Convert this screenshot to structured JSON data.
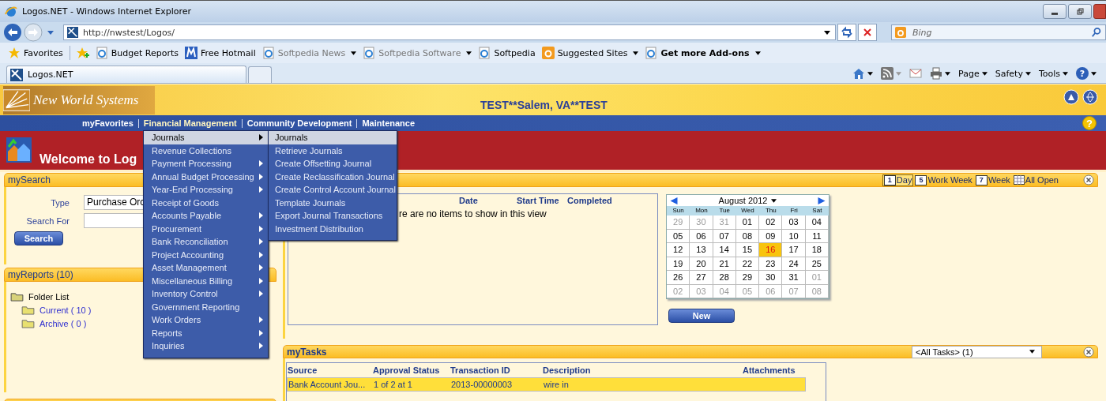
{
  "browser": {
    "title": "Logos.NET - Windows Internet Explorer",
    "address": "http://nwstest/Logos/",
    "search_placeholder": "Bing",
    "favorites_label": "Favorites",
    "favorites": [
      {
        "label": "Budget Reports",
        "dimmed": false,
        "has_menu": false,
        "bold": false
      },
      {
        "label": "Free Hotmail",
        "dimmed": false,
        "has_menu": false,
        "bold": false
      },
      {
        "label": "Softpedia News",
        "dimmed": true,
        "has_menu": true,
        "bold": false
      },
      {
        "label": "Softpedia Software",
        "dimmed": true,
        "has_menu": true,
        "bold": false
      },
      {
        "label": "Softpedia",
        "dimmed": false,
        "has_menu": false,
        "bold": false
      },
      {
        "label": "Suggested Sites",
        "dimmed": false,
        "has_menu": true,
        "bold": false
      },
      {
        "label": "Get more Add-ons",
        "dimmed": false,
        "has_menu": true,
        "bold": true
      }
    ],
    "tabs": [
      {
        "label": "Logos.NET",
        "selected": true
      }
    ],
    "commands": [
      {
        "kind": "home",
        "has_menu": true
      },
      {
        "kind": "feeds",
        "has_menu": true
      },
      {
        "kind": "mail",
        "has_menu": false
      },
      {
        "kind": "print",
        "has_menu": true
      },
      {
        "kind": "text",
        "label": "Page",
        "has_menu": true
      },
      {
        "kind": "text",
        "label": "Safety",
        "has_menu": true
      },
      {
        "kind": "text",
        "label": "Tools",
        "has_menu": true
      },
      {
        "kind": "help",
        "label": "?",
        "has_menu": true
      }
    ]
  },
  "app": {
    "brand": "New World Systems",
    "site": "TEST**Salem, VA**TEST",
    "help": "?",
    "welcome": "Welcome to Log",
    "nav": [
      {
        "label": "myFavorites",
        "selected": false
      },
      {
        "label": "Financial Management",
        "selected": true
      },
      {
        "label": "Community Development",
        "selected": false
      },
      {
        "label": "Maintenance",
        "selected": false
      }
    ],
    "main_menu": [
      {
        "label": "Journals",
        "has_submenu": true,
        "selected": true
      },
      {
        "label": "Revenue Collections",
        "has_submenu": false,
        "selected": false
      },
      {
        "label": "Payment Processing",
        "has_submenu": true,
        "selected": false
      },
      {
        "label": "Annual Budget Processing",
        "has_submenu": true,
        "selected": false
      },
      {
        "label": "Year-End Processing",
        "has_submenu": true,
        "selected": false
      },
      {
        "label": "Receipt of Goods",
        "has_submenu": false,
        "selected": false
      },
      {
        "label": "Accounts Payable",
        "has_submenu": true,
        "selected": false
      },
      {
        "label": "Procurement",
        "has_submenu": true,
        "selected": false
      },
      {
        "label": "Bank Reconciliation",
        "has_submenu": true,
        "selected": false
      },
      {
        "label": "Project Accounting",
        "has_submenu": true,
        "selected": false
      },
      {
        "label": "Asset Management",
        "has_submenu": true,
        "selected": false
      },
      {
        "label": "Miscellaneous Billing",
        "has_submenu": true,
        "selected": false
      },
      {
        "label": "Inventory Control",
        "has_submenu": true,
        "selected": false
      },
      {
        "label": "Government Reporting",
        "has_submenu": false,
        "selected": false
      },
      {
        "label": "Work Orders",
        "has_submenu": true,
        "selected": false
      },
      {
        "label": "Reports",
        "has_submenu": true,
        "selected": false
      },
      {
        "label": "Inquiries",
        "has_submenu": true,
        "selected": false
      }
    ],
    "submenu": [
      {
        "label": "Journals",
        "selected": true
      },
      {
        "label": "Retrieve Journals",
        "selected": false
      },
      {
        "label": "Create Offsetting Journal",
        "selected": false
      },
      {
        "label": "Create Reclassification Journal",
        "selected": false
      },
      {
        "label": "Create Control Account Journal",
        "selected": false
      },
      {
        "label": "Template Journals",
        "selected": false
      },
      {
        "label": "Export Journal Transactions",
        "selected": false
      },
      {
        "label": "Investment Distribution",
        "selected": false
      }
    ],
    "search_panel": {
      "title": "mySearch",
      "type_label": "Type",
      "type_value": "Purchase Orc",
      "search_for_label": "Search For",
      "button": "Search"
    },
    "reports_panel": {
      "title": "myReports (10)",
      "root": {
        "label": "Folder List",
        "children": [
          {
            "label": "Current ( 10 )"
          },
          {
            "label": "Archive ( 0 )"
          }
        ]
      }
    },
    "calendar_panel": {
      "views": [
        {
          "kind": "digit",
          "icon": "1",
          "label": "Day",
          "selected": true
        },
        {
          "kind": "digit",
          "icon": "5",
          "label": "Work Week",
          "selected": false
        },
        {
          "kind": "digit",
          "icon": "7",
          "label": "Week",
          "selected": false
        },
        {
          "kind": "grid",
          "label": "All Open",
          "selected": false
        }
      ],
      "columns": [
        "Date",
        "Start Time",
        "Completed"
      ],
      "empty_message": "re are no items to show in this view",
      "month": "August 2012",
      "weekdays": [
        "Sun",
        "Mon",
        "Tue",
        "Wed",
        "Thu",
        "Fri",
        "Sat"
      ],
      "weeks": [
        [
          {
            "day": "29",
            "other_month": true,
            "today": false
          },
          {
            "day": "30",
            "other_month": true,
            "today": false
          },
          {
            "day": "31",
            "other_month": true,
            "today": false
          },
          {
            "day": "01",
            "other_month": false,
            "today": false
          },
          {
            "day": "02",
            "other_month": false,
            "today": false
          },
          {
            "day": "03",
            "other_month": false,
            "today": false
          },
          {
            "day": "04",
            "other_month": false,
            "today": false
          }
        ],
        [
          {
            "day": "05",
            "other_month": false,
            "today": false
          },
          {
            "day": "06",
            "other_month": false,
            "today": false
          },
          {
            "day": "07",
            "other_month": false,
            "today": false
          },
          {
            "day": "08",
            "other_month": false,
            "today": false
          },
          {
            "day": "09",
            "other_month": false,
            "today": false
          },
          {
            "day": "10",
            "other_month": false,
            "today": false
          },
          {
            "day": "11",
            "other_month": false,
            "today": false
          }
        ],
        [
          {
            "day": "12",
            "other_month": false,
            "today": false
          },
          {
            "day": "13",
            "other_month": false,
            "today": false
          },
          {
            "day": "14",
            "other_month": false,
            "today": false
          },
          {
            "day": "15",
            "other_month": false,
            "today": false
          },
          {
            "day": "16",
            "other_month": false,
            "today": true
          },
          {
            "day": "17",
            "other_month": false,
            "today": false
          },
          {
            "day": "18",
            "other_month": false,
            "today": false
          }
        ],
        [
          {
            "day": "19",
            "other_month": false,
            "today": false
          },
          {
            "day": "20",
            "other_month": false,
            "today": false
          },
          {
            "day": "21",
            "other_month": false,
            "today": false
          },
          {
            "day": "22",
            "other_month": false,
            "today": false
          },
          {
            "day": "23",
            "other_month": false,
            "today": false
          },
          {
            "day": "24",
            "other_month": false,
            "today": false
          },
          {
            "day": "25",
            "other_month": false,
            "today": false
          }
        ],
        [
          {
            "day": "26",
            "other_month": false,
            "today": false
          },
          {
            "day": "27",
            "other_month": false,
            "today": false
          },
          {
            "day": "28",
            "other_month": false,
            "today": false
          },
          {
            "day": "29",
            "other_month": false,
            "today": false
          },
          {
            "day": "30",
            "other_month": false,
            "today": false
          },
          {
            "day": "31",
            "other_month": false,
            "today": false
          },
          {
            "day": "01",
            "other_month": true,
            "today": false
          }
        ],
        [
          {
            "day": "02",
            "other_month": true,
            "today": false
          },
          {
            "day": "03",
            "other_month": true,
            "today": false
          },
          {
            "day": "04",
            "other_month": true,
            "today": false
          },
          {
            "day": "05",
            "other_month": true,
            "today": false
          },
          {
            "day": "06",
            "other_month": true,
            "today": false
          },
          {
            "day": "07",
            "other_month": true,
            "today": false
          },
          {
            "day": "08",
            "other_month": true,
            "today": false
          }
        ]
      ],
      "new_button": "New"
    },
    "tasks_panel": {
      "title": "myTasks",
      "filter": "<All Tasks> (1)",
      "columns": [
        "Source",
        "Approval Status",
        "Transaction ID",
        "Description",
        "Attachments"
      ],
      "rows": [
        {
          "cells": [
            "Bank Account Jou...",
            "1 of 2 at 1",
            "2013-00000003",
            "wire in"
          ],
          "selected": true
        }
      ]
    }
  }
}
